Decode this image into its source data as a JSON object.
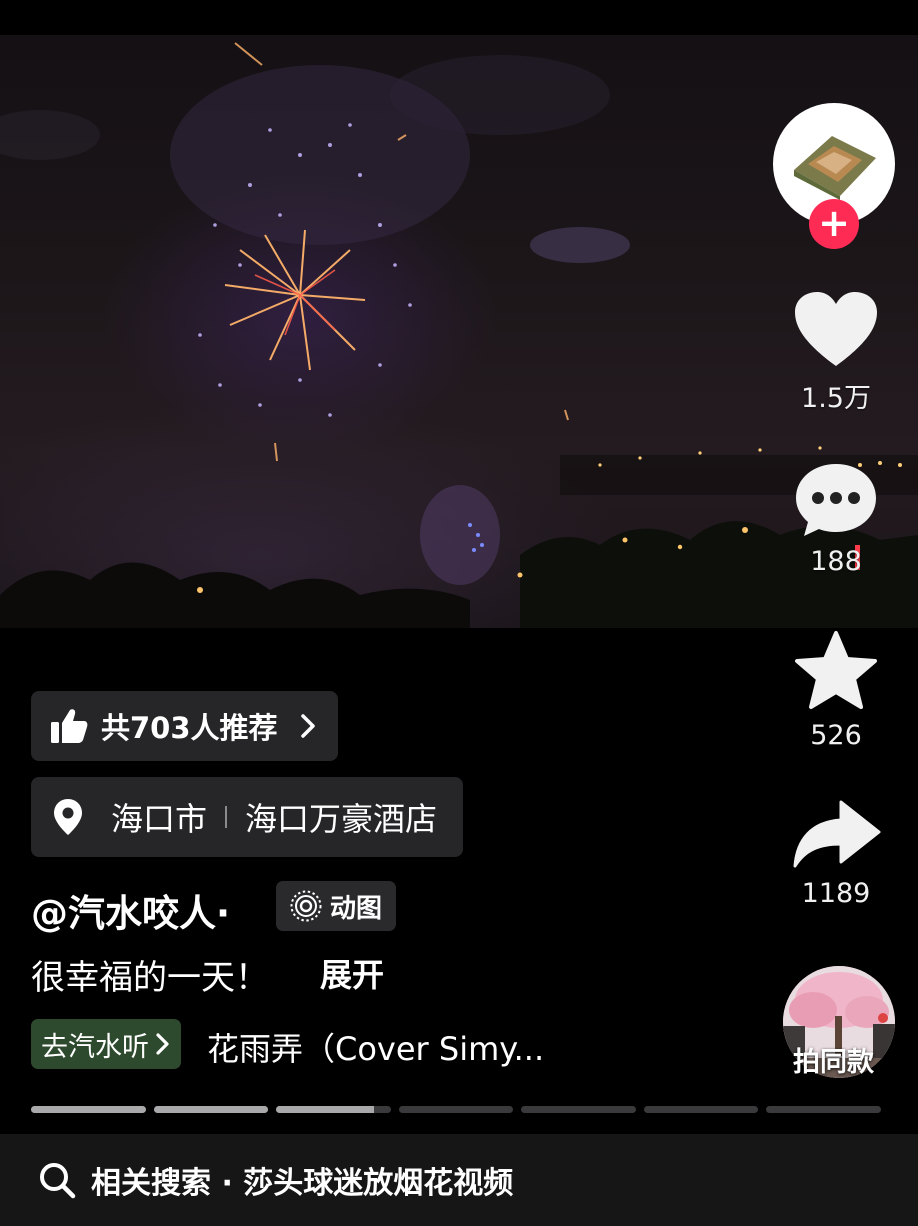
{
  "rail": {
    "likes": "1.5万",
    "comments": "188",
    "favorites": "526",
    "shares": "1189",
    "follow_symbol": "+"
  },
  "recommend": {
    "label": "共703人推荐"
  },
  "location": {
    "city": "海口市",
    "place": "海口万豪酒店"
  },
  "author": {
    "handle": "@汽水咬人·"
  },
  "tag": {
    "label": "动图"
  },
  "caption": {
    "text": "很幸福的一天！",
    "expand_label": "展开"
  },
  "music": {
    "tag_label": "去汽水听",
    "title": "花雨弄（Cover Simy..."
  },
  "same_style": {
    "label": "拍同款"
  },
  "progress": {
    "segments": 7,
    "current_segment": 3,
    "current_fraction": 0.85
  },
  "search": {
    "text": "相关搜索 · 莎头球迷放烟花视频"
  },
  "colors": {
    "accent": "#fe2c55",
    "music_tag_bg": "#2e4a2e",
    "panel": "#262628"
  },
  "icons": [
    "heart-icon",
    "comment-icon",
    "star-icon",
    "share-icon",
    "thumbs-up-icon",
    "location-pin-icon",
    "live-photo-icon",
    "search-icon",
    "chevron-right-icon"
  ]
}
